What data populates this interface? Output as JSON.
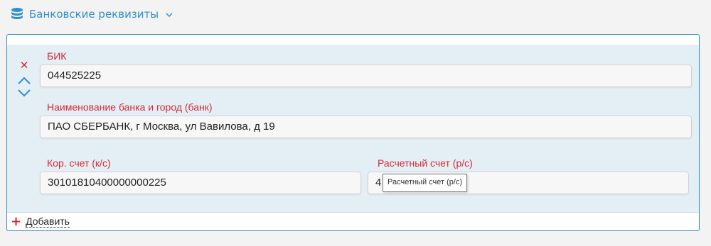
{
  "section": {
    "title": "Банковские реквизиты",
    "icon": "database-icon",
    "accent": "#2f8fcf"
  },
  "record": {
    "remove_icon": "close-icon",
    "move_up_icon": "chevron-up-icon",
    "move_down_icon": "chevron-down-icon",
    "bik": {
      "label": "БИК",
      "value": "044525225"
    },
    "bank_name": {
      "label": "Наименование банка и город (банк)",
      "value": "ПАО СБЕРБАНК, г Москва, ул Вавилова, д 19"
    },
    "corr_account": {
      "label": "Кор. счет (к/с)",
      "value": "30101810400000000225"
    },
    "settlement_account": {
      "label": "Расчетный счет (р/с)",
      "value": "4"
    }
  },
  "tooltip": {
    "text": "Расчетный счет (р/с)"
  },
  "add": {
    "label": "Добавить",
    "icon": "plus-icon"
  },
  "colors": {
    "label_red": "#d12a3a",
    "panel_bg": "#e4eff5",
    "border_blue": "#2f8fcf"
  }
}
